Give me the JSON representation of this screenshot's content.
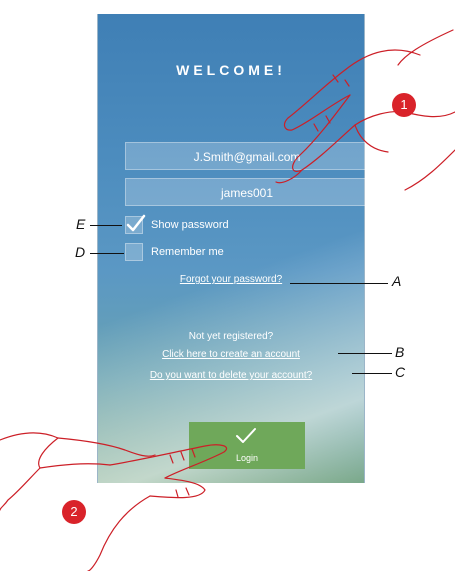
{
  "login_screen": {
    "title": "WELCOME!",
    "email_value": "J.Smith@gmail.com",
    "password_value": "james001",
    "show_password_label": "Show password",
    "show_password_checked": true,
    "remember_me_label": "Remember me",
    "remember_me_checked": false,
    "forgot_password_link": "Forgot your password?",
    "not_registered_text": "Not yet registered?",
    "create_account_link": "Click here to create an account",
    "delete_account_link": "Do you want to delete your account?",
    "login_button_label": "Login"
  },
  "annotations": {
    "A": "A",
    "B": "B",
    "C": "C",
    "D": "D",
    "E": "E",
    "step1": "1",
    "step2": "2"
  },
  "colors": {
    "accent_login": "#6fa85a",
    "badge": "#d9232a"
  }
}
